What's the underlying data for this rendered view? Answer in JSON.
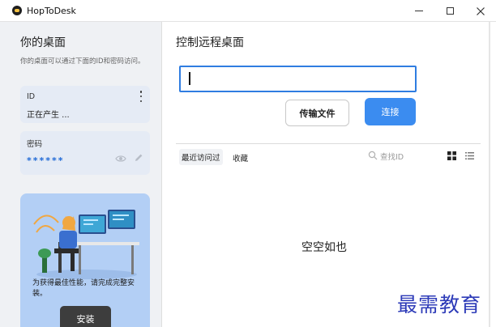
{
  "window": {
    "title": "HopToDesk"
  },
  "left": {
    "title": "你的桌面",
    "description": "你的桌面可以通过下面的ID和密码访问。",
    "id_card": {
      "label": "ID",
      "value": "正在产生 ..."
    },
    "password_card": {
      "label": "密码",
      "value": "******"
    },
    "promo": {
      "text": "为获得最佳性能，请完成完整安装。",
      "install_label": "安装"
    }
  },
  "main": {
    "title": "控制远程桌面",
    "id_input": {
      "value": ""
    },
    "transfer_label": "传输文件",
    "connect_label": "连接",
    "tabs": [
      {
        "label": "最近访问过",
        "active": true
      },
      {
        "label": "收藏",
        "active": false
      }
    ],
    "search_placeholder": "查找ID",
    "empty_text": "空空如也"
  },
  "watermark": "最需教育",
  "colors": {
    "accent": "#3b8cf0",
    "input_border": "#2f7de1",
    "sidebar_bg": "#eff1f4",
    "card_bg": "#e5ebf5",
    "promo_bg": "#b3cff5",
    "install_bg": "#3d3d3d",
    "watermark": "#2d3bb8"
  },
  "icons": {
    "app": "hoptodesk-logo-icon",
    "more": "kebab-menu-icon",
    "show_password": "eye-icon",
    "edit_password": "pencil-icon",
    "search": "search-icon",
    "grid_view": "grid-view-icon",
    "list_view": "list-view-icon"
  }
}
